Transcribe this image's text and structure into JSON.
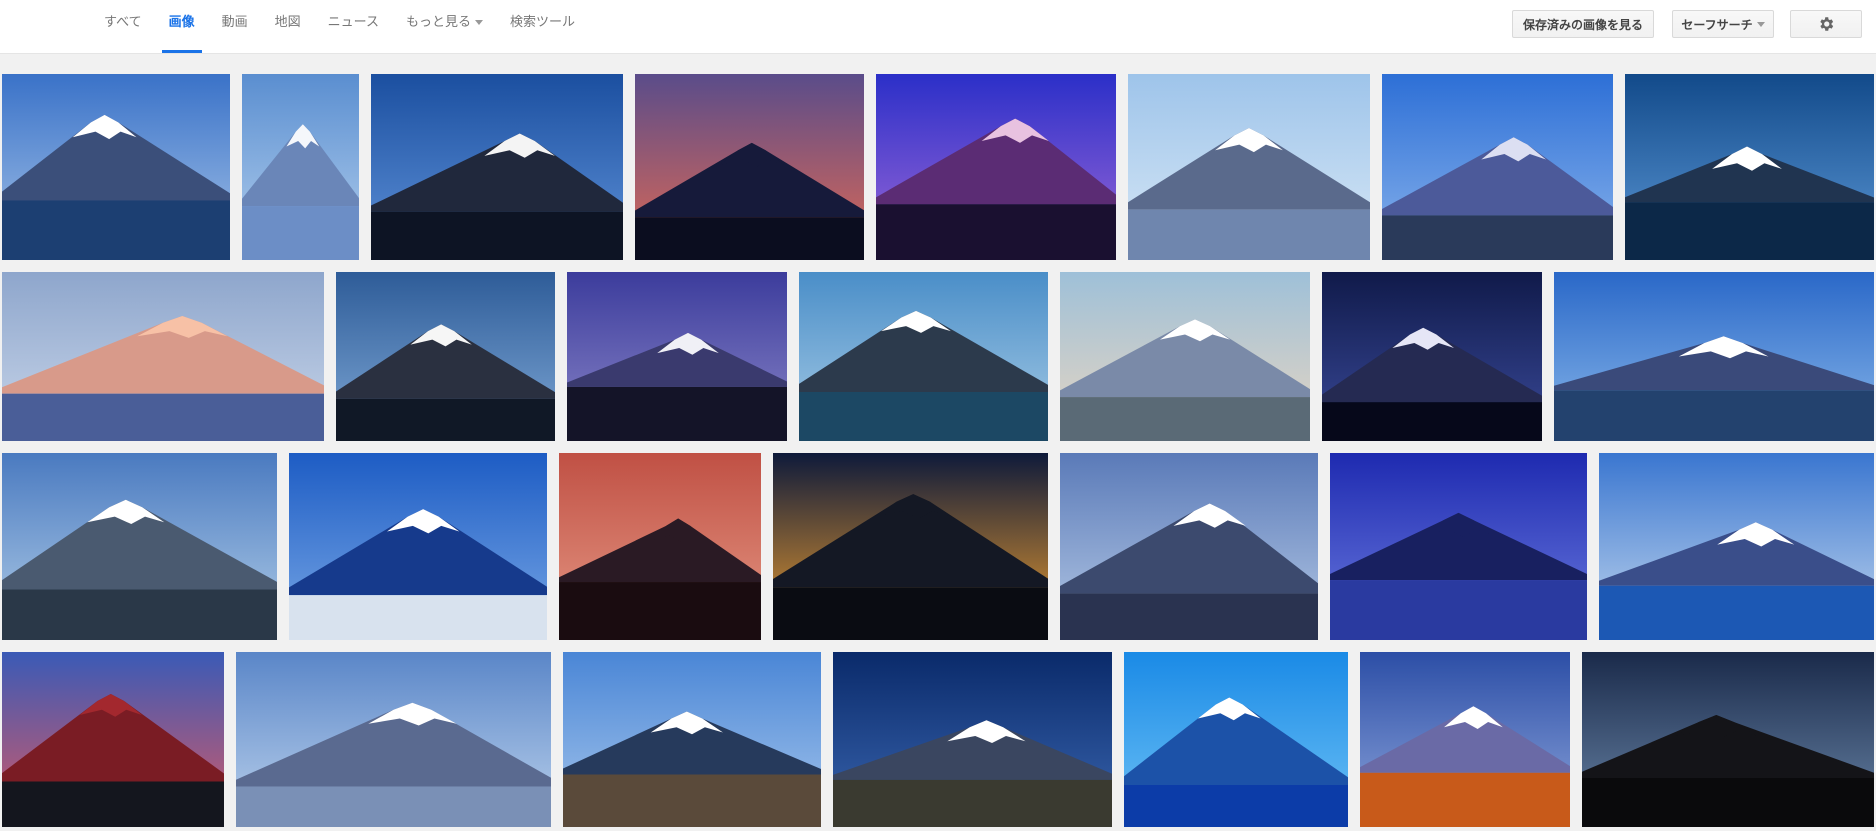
{
  "tabs": [
    {
      "label": "すべて",
      "active": false
    },
    {
      "label": "画像",
      "active": true
    },
    {
      "label": "動画",
      "active": false
    },
    {
      "label": "地図",
      "active": false
    },
    {
      "label": "ニュース",
      "active": false
    },
    {
      "label": "もっと見る",
      "active": false,
      "dropdown": true
    },
    {
      "label": "検索ツール",
      "active": false
    }
  ],
  "toolbar": {
    "saved_images_label": "保存済みの画像を見る",
    "safesearch_label": "セーフサーチ",
    "settings_icon": "gear-icon"
  },
  "results": [
    {
      "sky": [
        "#3a72c8",
        "#a6c4e8"
      ],
      "mountain": "#3b4f7a",
      "snow": "#ffffff",
      "ground": "#1c3f72"
    },
    {
      "sky": [
        "#5a8ed0",
        "#b4d0ee"
      ],
      "mountain": "#6a86b8",
      "snow": "#f5f7fb",
      "ground": "#6c8ec6"
    },
    {
      "sky": [
        "#1b4fa0",
        "#5f92d8"
      ],
      "mountain": "#20283c",
      "snow": "#f4f4f4",
      "ground": "#0d1424"
    },
    {
      "sky": [
        "#5a4c8a",
        "#e06a54"
      ],
      "mountain": "#161a3a",
      "snow": "#161a3a",
      "ground": "#0b0d1f"
    },
    {
      "sky": [
        "#2b2fc8",
        "#9f6ad8"
      ],
      "mountain": "#5b2c74",
      "snow": "#e8c2e0",
      "ground": "#1a1030"
    },
    {
      "sky": [
        "#9ec4ea",
        "#d8e8f6"
      ],
      "mountain": "#5a6a8c",
      "snow": "#ffffff",
      "ground": "#6f86ae"
    },
    {
      "sky": [
        "#2d6fd6",
        "#8ab4ec"
      ],
      "mountain": "#4c5a9a",
      "snow": "#dcdff2",
      "ground": "#2a3a5a"
    },
    {
      "sky": [
        "#124a8a",
        "#5c98d6"
      ],
      "mountain": "#203450",
      "snow": "#ffffff",
      "ground": "#0c2848"
    },
    {
      "sky": [
        "#8ea6cc",
        "#c9d6ea"
      ],
      "mountain": "#d89a8a",
      "snow": "#f7c1a6",
      "ground": "#4a5e98"
    },
    {
      "sky": [
        "#2e5c98",
        "#7fa8d6"
      ],
      "mountain": "#2a3040",
      "snow": "#f6f6f6",
      "ground": "#101826"
    },
    {
      "sky": [
        "#3c3c9c",
        "#8a86c8"
      ],
      "mountain": "#3a3a6e",
      "snow": "#f0f0f6",
      "ground": "#141428"
    },
    {
      "sky": [
        "#4a8ec8",
        "#a8cce6"
      ],
      "mountain": "#2c3a4c",
      "snow": "#ffffff",
      "ground": "#1c4864"
    },
    {
      "sky": [
        "#9ec0d8",
        "#e8d6c2"
      ],
      "mountain": "#7a8aa8",
      "snow": "#ffffff",
      "ground": "#5a6a76"
    },
    {
      "sky": [
        "#101a4a",
        "#3a4a9a"
      ],
      "mountain": "#252a52",
      "snow": "#e6e6f6",
      "ground": "#06081a"
    },
    {
      "sky": [
        "#2a68c8",
        "#8ab8ea"
      ],
      "mountain": "#3a4a7a",
      "snow": "#ffffff",
      "ground": "#23426e"
    },
    {
      "sky": [
        "#4a7ac0",
        "#b2cee8"
      ],
      "mountain": "#4a5a70",
      "snow": "#ffffff",
      "ground": "#2a3848"
    },
    {
      "sky": [
        "#1d5cc4",
        "#79a8e6"
      ],
      "mountain": "#163a8c",
      "snow": "#ffffff",
      "ground": "#d8e2ee"
    },
    {
      "sky": [
        "#c05044",
        "#e69a86"
      ],
      "mountain": "#2a1a24",
      "snow": "#2a1a24",
      "ground": "#1a0c10"
    },
    {
      "sky": [
        "#0e1a3a",
        "#f0a030"
      ],
      "mountain": "#141824",
      "snow": "#141824",
      "ground": "#0a0c12"
    },
    {
      "sky": [
        "#5a7ab8",
        "#b6cae6"
      ],
      "mountain": "#3c4a6e",
      "snow": "#ffffff",
      "ground": "#2a3350"
    },
    {
      "sky": [
        "#1e2ab0",
        "#6c7ce0"
      ],
      "mountain": "#182060",
      "snow": "#182060",
      "ground": "#2a3aa0"
    },
    {
      "sky": [
        "#3a76d0",
        "#c4d8ee"
      ],
      "mountain": "#3a4e8a",
      "snow": "#ffffff",
      "ground": "#1c58b4"
    },
    {
      "sky": [
        "#3a5ab6",
        "#d85a66"
      ],
      "mountain": "#7a1c24",
      "snow": "#a3282e",
      "ground": "#14161e"
    },
    {
      "sky": [
        "#5a86c8",
        "#bcd2ec"
      ],
      "mountain": "#5a6a90",
      "snow": "#ffffff",
      "ground": "#7a90b6"
    },
    {
      "sky": [
        "#4a86d6",
        "#a6c6ec"
      ],
      "mountain": "#263a5c",
      "snow": "#ffffff",
      "ground": "#5a4a3a"
    },
    {
      "sky": [
        "#0a2a6a",
        "#3a66b0"
      ],
      "mountain": "#3a4660",
      "snow": "#ffffff",
      "ground": "#3a3a30"
    },
    {
      "sky": [
        "#1a8ae6",
        "#6ec2f6"
      ],
      "mountain": "#1c52a8",
      "snow": "#ffffff",
      "ground": "#0c3ca8"
    },
    {
      "sky": [
        "#2c4ea6",
        "#8ea6dc"
      ],
      "mountain": "#6a6aa6",
      "snow": "#ffffff",
      "ground": "#c85a1a"
    },
    {
      "sky": [
        "#1a2a4a",
        "#6a86a8"
      ],
      "mountain": "#141418",
      "snow": "#141418",
      "ground": "#0a0a0c"
    }
  ]
}
